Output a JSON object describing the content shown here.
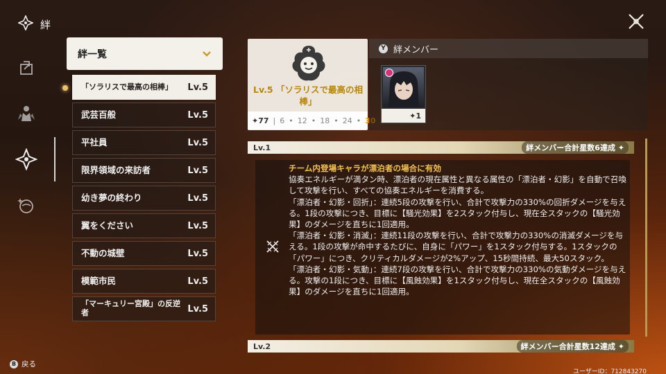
{
  "header": {
    "title": "絆",
    "close_icon": "crossed-lines-close-icon"
  },
  "rail": {
    "items": [
      {
        "icon": "export-arrow-icon"
      },
      {
        "icon": "characters-silhouette-icon"
      },
      {
        "icon": "bond-star-icon",
        "active": true
      },
      {
        "icon": "gift-orb-icon"
      }
    ]
  },
  "bond_list": {
    "header_label": "絆一覧",
    "items": [
      {
        "name": "「ソラリスで最高の相棒」",
        "level": "Lv.5",
        "selected": true
      },
      {
        "name": "武芸百般",
        "level": "Lv.5"
      },
      {
        "name": "平社員",
        "level": "Lv.5"
      },
      {
        "name": "限界領域の来訪者",
        "level": "Lv.5"
      },
      {
        "name": "幼き夢の終わり",
        "level": "Lv.5"
      },
      {
        "name": "翼をください",
        "level": "Lv.5"
      },
      {
        "name": "不動の城壁",
        "level": "Lv.5"
      },
      {
        "name": "模範市民",
        "level": "Lv.5"
      },
      {
        "name": "「マーキュリー宮殿」の反逆者",
        "level": "Lv.5"
      }
    ]
  },
  "detail": {
    "level_prefix": "Lv.5",
    "bond_name": "「ソラリスで最高の相棒」",
    "star_total": "✦77",
    "thresholds": [
      "6",
      "12",
      "18",
      "24",
      "30"
    ],
    "members_label": "絆メンバー",
    "members_button": "Y",
    "member_star": "✦1"
  },
  "levels": [
    {
      "label": "Lv.1",
      "requirement": "絆メンバー合計星数6達成 ✦"
    },
    {
      "label": "Lv.2",
      "requirement": "絆メンバー合計星数12達成 ✦"
    }
  ],
  "effect": {
    "head": "チーム内登場キャラが漂泊者の場合に有効",
    "lines": [
      "協奏エネルギーが満タン時、漂泊者の現在属性と異なる属性の「漂泊者・幻影」を自動で召喚して攻撃を行い、すべての協奏エネルギーを消費する。",
      "「漂泊者・幻影・回折」：連続5段の攻撃を行い、合計で攻撃力の330%の回折ダメージを与える。1段の攻撃につき、目標に【騒光効果】を2スタック付与し、現在全スタックの【騒光効果】のダメージを直ちに1回適用。",
      "「漂泊者・幻影・消滅」：連続11段の攻撃を行い、合計で攻撃力の330%の消滅ダメージを与える。1段の攻撃が命中するたびに、自身に「パワー」を1スタック付与する。1スタックの「パワー」につき、クリティカルダメージが2%アップ、15秒間持続、最大50スタック。",
      "「漂泊者・幻影・気動」：連続7段の攻撃を行い、合計で攻撃力の330%の気動ダメージを与える。攻撃の1段につき、目標に【風蝕効果】を1スタック付与し、現在全スタックの【風蝕効果】のダメージを直ちに1回適用。"
    ]
  },
  "footer": {
    "back_button": "B",
    "back_label": "戻る",
    "user_id": "ユーザーID：712843270"
  },
  "colors": {
    "accent_gold": "#f2c14f",
    "highlight_orange": "#e28a00"
  }
}
